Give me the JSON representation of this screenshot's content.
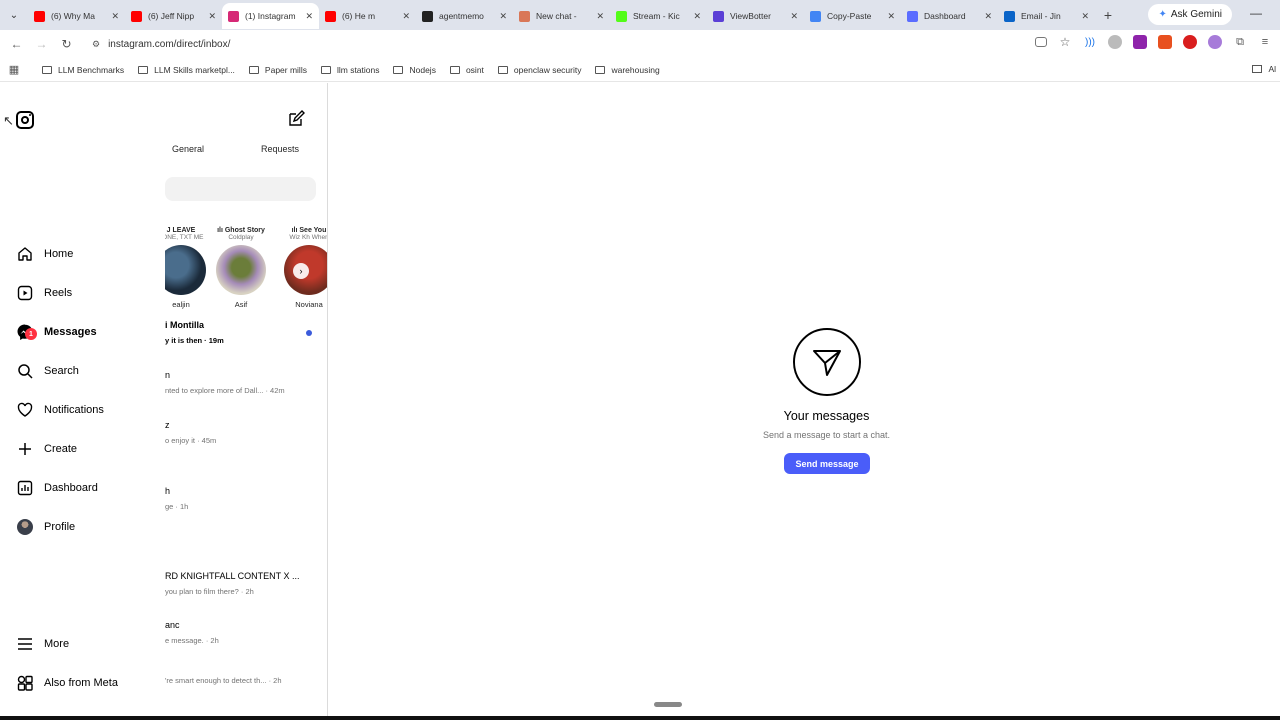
{
  "browser": {
    "tabs": [
      {
        "title": "(6) Why Ma",
        "color": "#ff0000",
        "active": false
      },
      {
        "title": "(6) Jeff Nipp",
        "color": "#ff0000",
        "active": false
      },
      {
        "title": "(1) Instagram",
        "color": "#d62976",
        "active": true
      },
      {
        "title": "(6) He m",
        "color": "#ff0000",
        "active": false
      },
      {
        "title": "agentmemo",
        "color": "#222222",
        "active": false
      },
      {
        "title": "New chat -",
        "color": "#d97757",
        "active": false
      },
      {
        "title": "Stream - Kic",
        "color": "#53fc18",
        "active": false
      },
      {
        "title": "ViewBotter",
        "color": "#5b3fd6",
        "active": false
      },
      {
        "title": "Copy-Paste",
        "color": "#4285f4",
        "active": false
      },
      {
        "title": "Dashboard",
        "color": "#5a6cff",
        "active": false
      },
      {
        "title": "Email - Jin",
        "color": "#0a64c8",
        "active": false
      }
    ],
    "gemini_label": "Ask Gemini",
    "url": "instagram.com/direct/inbox/",
    "bookmarks": [
      "LLM Benchmarks",
      "LLM Skills marketpl...",
      "Paper mills",
      "llm stations",
      "Nodejs",
      "osint",
      "openclaw security",
      "warehousing"
    ],
    "bookmarks_right": "Al"
  },
  "nav": {
    "items": [
      {
        "label": "Home",
        "icon": "home-icon"
      },
      {
        "label": "Reels",
        "icon": "reels-icon"
      },
      {
        "label": "Messages",
        "icon": "messenger-icon",
        "badge": "1"
      },
      {
        "label": "Search",
        "icon": "search-icon"
      },
      {
        "label": "Notifications",
        "icon": "heart-icon"
      },
      {
        "label": "Create",
        "icon": "plus-icon"
      },
      {
        "label": "Dashboard",
        "icon": "dashboard-icon"
      },
      {
        "label": "Profile",
        "icon": "avatar"
      }
    ],
    "more": "More",
    "also_from_meta": "Also from Meta"
  },
  "inbox": {
    "tab_general": "General",
    "tab_requests": "Requests",
    "notes": [
      {
        "bubble": "J LEAVE",
        "sub": "LONE, TXT ME",
        "name": "ealjin"
      },
      {
        "bubble": "ılı Ghost Story",
        "sub": "Coldplay",
        "name": "Asif"
      },
      {
        "bubble": "ılı See You",
        "sub": "Wiz Kh When",
        "name": "Noviana"
      }
    ],
    "conversations": [
      {
        "name": "i Montilla",
        "preview": "y it is then · 19m",
        "unread": true
      },
      {
        "name": "n",
        "preview": "nted to explore more of Dall... · 42m",
        "unread": false
      },
      {
        "name": "z",
        "preview": "o enjoy it · 45m",
        "unread": false
      },
      {
        "name": "h",
        "preview": "ge · 1h",
        "unread": false
      },
      {
        "name": "RD KNIGHTFALL CONTENT X ...",
        "preview": "you plan to film there? · 2h",
        "unread": false
      },
      {
        "name": "anc",
        "preview": "e message. · 2h",
        "unread": false
      },
      {
        "name": "",
        "preview": "'re smart enough to detect th... · 2h",
        "unread": false
      }
    ]
  },
  "main": {
    "title": "Your messages",
    "subtitle": "Send a message to start a chat.",
    "button": "Send message"
  }
}
